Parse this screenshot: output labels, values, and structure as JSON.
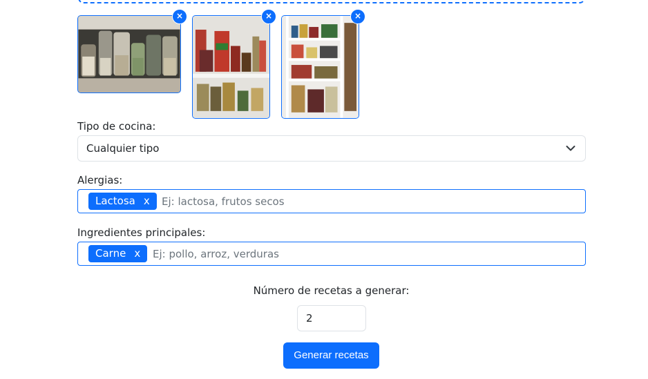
{
  "images": [
    {
      "alt": "Estante con frascos de legumbres",
      "remove_label": "×"
    },
    {
      "alt": "Despensa con latas y conservas",
      "remove_label": "×"
    },
    {
      "alt": "Despensa con estantes blancos",
      "remove_label": "×"
    }
  ],
  "cuisine": {
    "label": "Tipo de cocina:",
    "selected": "Cualquier tipo"
  },
  "allergies": {
    "label": "Alergias:",
    "tags": [
      {
        "text": "Lactosa",
        "remove": "x"
      }
    ],
    "placeholder": "Ej: lactosa, frutos secos"
  },
  "ingredients": {
    "label": "Ingredientes principales:",
    "tags": [
      {
        "text": "Carne",
        "remove": "x"
      }
    ],
    "placeholder": "Ej: pollo, arroz, verduras"
  },
  "recipes_count": {
    "label": "Número de recetas a generar:",
    "value": "2"
  },
  "submit_label": "Generar recetas",
  "colors": {
    "primary": "#0d6efd",
    "border": "#dee2e6",
    "muted": "#6c757d"
  }
}
